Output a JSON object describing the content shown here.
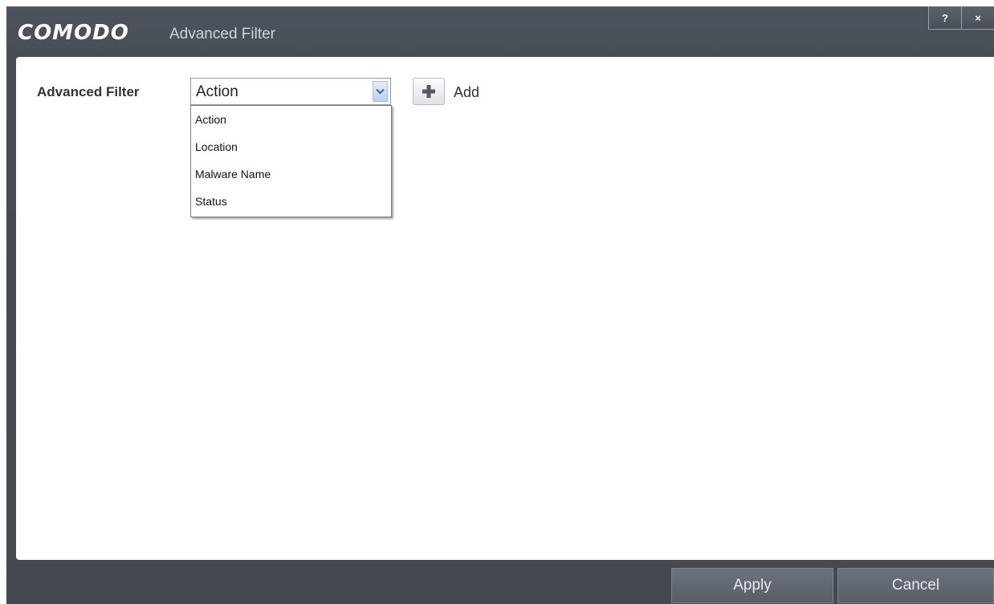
{
  "window": {
    "brand": "COMODO",
    "title": "Advanced Filter",
    "help_label": "?",
    "close_label": "×"
  },
  "filter": {
    "label": "Advanced Filter",
    "selected": "Action",
    "add_label": "Add",
    "options": [
      "Action",
      "Location",
      "Malware Name",
      "Status"
    ]
  },
  "footer": {
    "apply_label": "Apply",
    "cancel_label": "Cancel"
  },
  "icons": {
    "dropdown": "chevron-down-icon",
    "add": "plus-icon"
  }
}
